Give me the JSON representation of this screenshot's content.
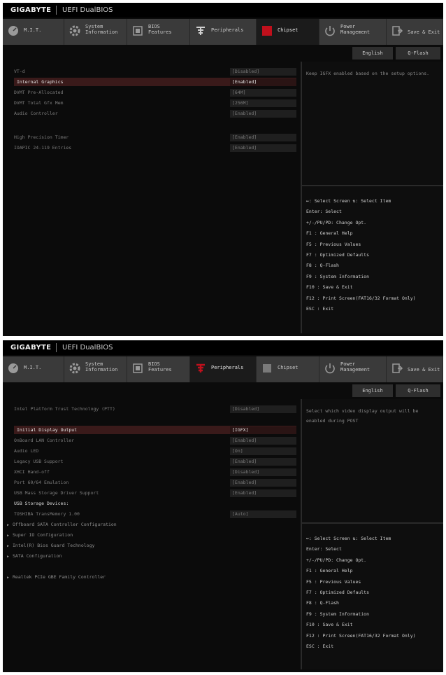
{
  "brand": "GIGABYTE",
  "product": "UEFI DualBIOS",
  "colors": {
    "accent_red": "#c0101c",
    "highlight_row": "#3a1a1a",
    "panel_dark": "#0b0b0b",
    "tab_bg": "#3a3a3a"
  },
  "tabs": [
    {
      "label": "M.I.T.",
      "icon": "mit-gauge-icon"
    },
    {
      "label": "System\nInformation",
      "icon": "gear-icon"
    },
    {
      "label": "BIOS\nFeatures",
      "icon": "bios-chip-icon"
    },
    {
      "label": "Peripherals",
      "icon": "peripherals-icon"
    },
    {
      "label": "Chipset",
      "icon": "chipset-icon"
    },
    {
      "label": "Power\nManagement",
      "icon": "power-icon"
    },
    {
      "label": "Save & Exit",
      "icon": "exit-door-icon"
    }
  ],
  "subbar": {
    "language": "English",
    "qflash": "Q-Flash"
  },
  "key_help": [
    "↔: Select Screen  ⇅: Select Item",
    "Enter: Select",
    "+/-/PU/PD: Change Opt.",
    "F1  : General Help",
    "F5  : Previous Values",
    "F7  : Optimized Defaults",
    "F8  : Q-Flash",
    "F9  : System Information",
    "F10 : Save & Exit",
    "F12 : Print Screen(FAT16/32 Format Only)",
    "ESC : Exit"
  ],
  "screen1": {
    "active_tab": "Chipset",
    "help_text": "Keep IGFX enabled based on the setup options.",
    "rows": [
      {
        "label": "VT-d",
        "value": "[Disabled]"
      },
      {
        "label": "Internal Graphics",
        "value": "[Enabled]",
        "selected": true
      },
      {
        "label": "DVMT Pre-Allocated",
        "value": "[64M]"
      },
      {
        "label": "DVMT Total Gfx Mem",
        "value": "[256M]"
      },
      {
        "label": "Audio Controller",
        "value": "[Enabled]"
      },
      {
        "label": "High Precision Timer",
        "value": "[Enabled]"
      },
      {
        "label": "IOAPIC 24-119 Entries",
        "value": "[Enabled]"
      }
    ]
  },
  "screen2": {
    "active_tab": "Peripherals",
    "help_text": "Select which video display output will be enabled during POST",
    "rows": [
      {
        "label": "Intel Platform Trust Technology (PTT)",
        "value": "[Disabled]"
      },
      {
        "label": "Initial Display Output",
        "value": "[IGFX]",
        "selected": true
      },
      {
        "label": "OnBoard LAN Controller",
        "value": "[Enabled]"
      },
      {
        "label": "Audio LED",
        "value": "[On]"
      },
      {
        "label": "Legacy USB Support",
        "value": "[Enabled]"
      },
      {
        "label": "XHCI Hand-off",
        "value": "[Disabled]"
      },
      {
        "label": "Port 60/64 Emulation",
        "value": "[Enabled]"
      },
      {
        "label": "USB Mass Storage Driver Support",
        "value": "[Enabled]"
      },
      {
        "label": "USB Storage Devices:",
        "heading": true
      },
      {
        "label": "TOSHIBA TransMemory 1.00",
        "value": "[Auto]"
      },
      {
        "label": "Offboard SATA Controller Configuration",
        "submenu": true
      },
      {
        "label": "Super IO Configuration",
        "submenu": true
      },
      {
        "label": "Intel(R) Bios Guard Technology",
        "submenu": true
      },
      {
        "label": "SATA Configuration",
        "submenu": true
      },
      {
        "label": "Realtek PCIe GBE Family Controller",
        "submenu": true
      }
    ]
  }
}
